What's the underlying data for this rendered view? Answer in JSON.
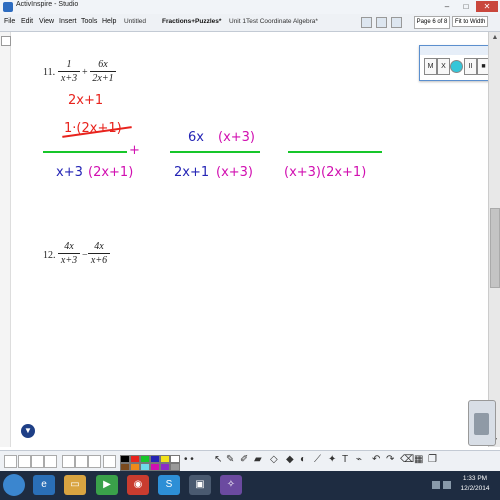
{
  "window": {
    "title": "ActivInspire - Studio",
    "controls": {
      "minimize": "–",
      "maximize": "□",
      "close": "✕"
    }
  },
  "menu": {
    "items": [
      "File",
      "Edit",
      "View",
      "Insert",
      "Tools",
      "Help"
    ],
    "tabs": [
      "Untitled",
      "Fractions+Puzzles*",
      "Unit 1Test Coordinate Algebra*"
    ],
    "active_tab": "Fractions+Puzzles*",
    "page_indicator": "Page 6 of 8",
    "zoom": "Fit to Width"
  },
  "recorder": {
    "buttons": [
      "M",
      "X",
      "II",
      "■"
    ]
  },
  "problems": {
    "p11": {
      "number": "11.",
      "term1_num": "1",
      "term1_den": "x+3",
      "operator": "+",
      "term2_num": "6x",
      "term2_den": "2x+1"
    },
    "p12": {
      "number": "12.",
      "term1_num": "4x",
      "term1_den": "x+3",
      "operator": "−",
      "term2_num": "4x",
      "term2_den": "x+6"
    }
  },
  "handwriting": {
    "red_top": "2x+1",
    "red_crossed": "1·(2x+1)",
    "blue_den1": "x+3",
    "magenta_den1": "(2x+1)",
    "plus": "+",
    "blue_num2": "6x",
    "magenta_num2": "(x+3)",
    "blue_den2": "2x+1",
    "magenta_den2": "(x+3)",
    "magenta_result": "(x+3)(2x+1)"
  },
  "navigation": {
    "page_nav_glyph": "▼"
  },
  "taskbar": {
    "time": "1:33 PM",
    "date": "12/2/2014"
  },
  "colors": {
    "red_ink": "#e8231d",
    "blue_ink": "#2424b5",
    "magenta_ink": "#d10fb0",
    "green_line": "#17c62a",
    "taskbar": "#1e2c41"
  }
}
